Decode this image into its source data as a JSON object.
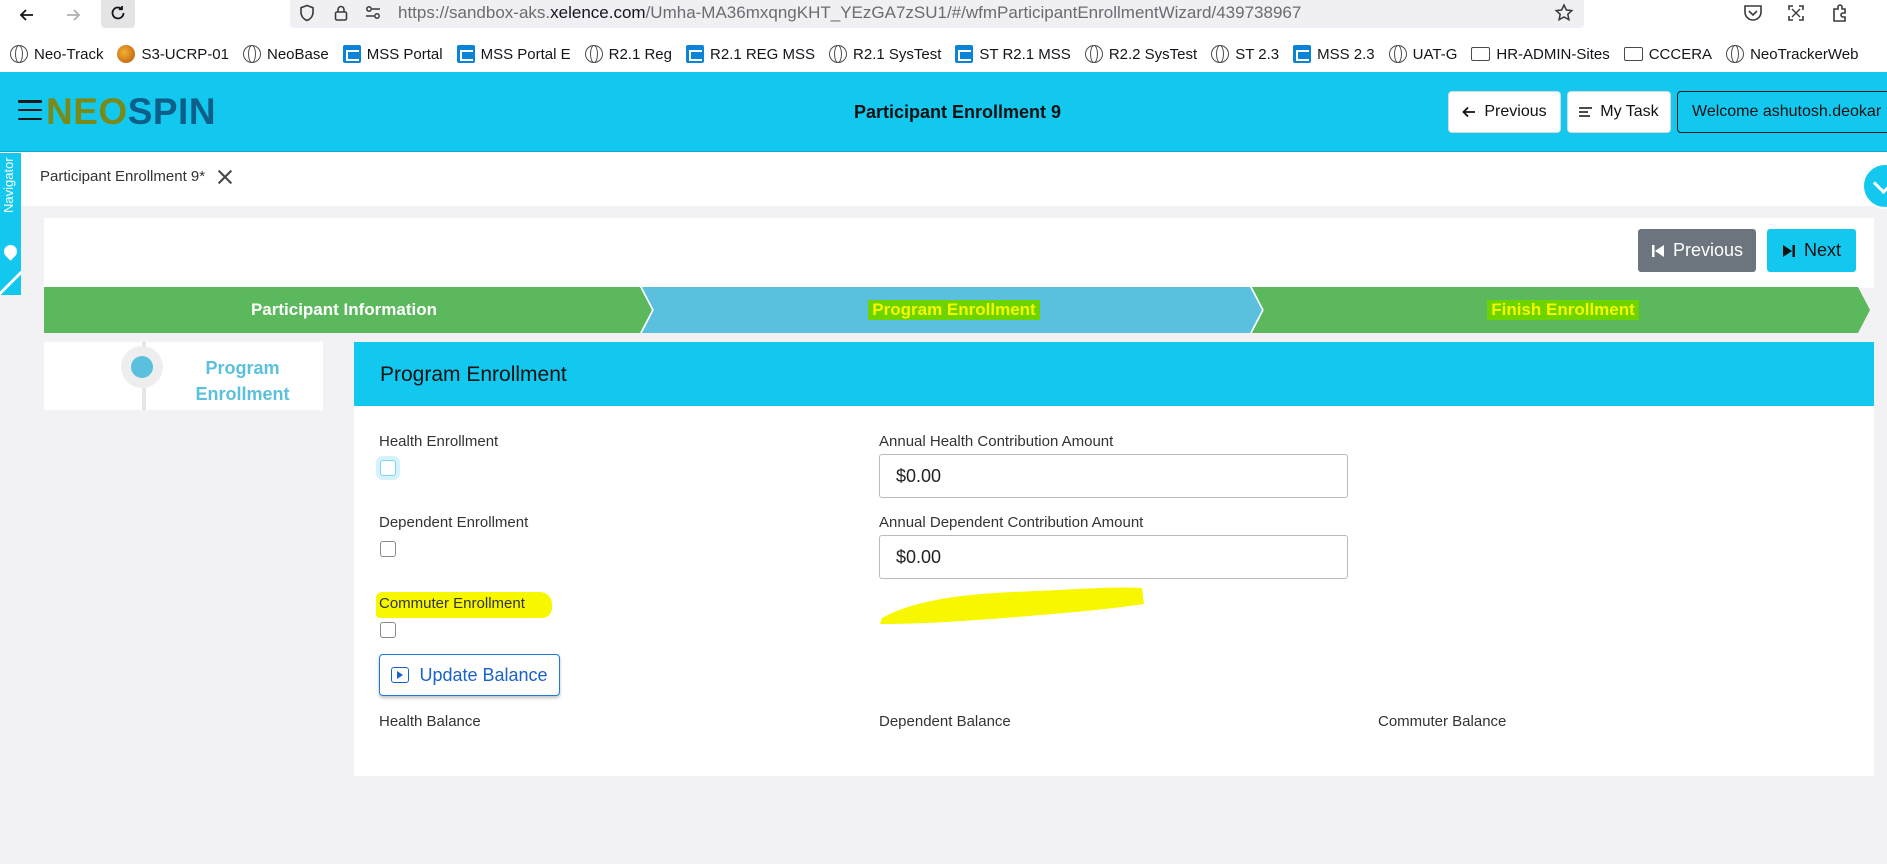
{
  "browser": {
    "url_prefix": "https://sandbox-aks.",
    "url_domain": "xelence.com",
    "url_path": "/Umha-MA36mxqngKHT_YEzGA7zSU1/#/wfmParticipantEnrollmentWizard/439738967",
    "bookmarks": [
      {
        "label": "Neo-Track",
        "icon": "globe-icon"
      },
      {
        "label": "S3-UCRP-01",
        "icon": "orange-logo-icon"
      },
      {
        "label": "NeoBase",
        "icon": "globe-icon"
      },
      {
        "label": "MSS Portal",
        "icon": "mss-icon"
      },
      {
        "label": "MSS Portal E",
        "icon": "mss-icon"
      },
      {
        "label": "R2.1 Reg",
        "icon": "globe-icon"
      },
      {
        "label": "R2.1 REG MSS",
        "icon": "mss-icon"
      },
      {
        "label": "R2.1 SysTest",
        "icon": "globe-icon"
      },
      {
        "label": "ST R2.1 MSS",
        "icon": "mss-icon"
      },
      {
        "label": "R2.2 SysTest",
        "icon": "globe-icon"
      },
      {
        "label": "ST 2.3",
        "icon": "globe-icon"
      },
      {
        "label": "MSS 2.3",
        "icon": "mss-icon"
      },
      {
        "label": "UAT-G",
        "icon": "globe-icon"
      },
      {
        "label": "HR-ADMIN-Sites",
        "icon": "folder-icon"
      },
      {
        "label": "CCCERA",
        "icon": "folder-icon"
      },
      {
        "label": "NeoTrackerWeb",
        "icon": "globe-icon"
      }
    ]
  },
  "header": {
    "logo_part1": "NEO",
    "logo_part2": "SPIN",
    "title": "Participant Enrollment 9",
    "previous_label": "Previous",
    "mytask_label": "My Task",
    "welcome_label": "Welcome ashutosh.deokar"
  },
  "tabs": {
    "navigator_label": "Navigator",
    "active_tab_label": "Participant Enrollment 9*"
  },
  "wizard": {
    "previous_label": "Previous",
    "next_label": "Next",
    "steps": [
      {
        "label": "Participant Information",
        "color": "#5cb85c",
        "text_color": "#ffffff"
      },
      {
        "label": "Program Enrollment",
        "color": "#5bc0de",
        "text_color": "#f7f700",
        "highlight": "#6dd400"
      },
      {
        "label": "Finish Enrollment",
        "color": "#5cb85c",
        "text_color": "#f7f700",
        "highlight": "#6dd400"
      }
    ],
    "side_step_label": "Program Enrollment"
  },
  "panel": {
    "title": "Program Enrollment",
    "health_enrollment_label": "Health Enrollment",
    "dependent_enrollment_label": "Dependent Enrollment",
    "commuter_enrollment_label": "Commuter Enrollment",
    "annual_health_label": "Annual Health Contribution Amount",
    "annual_health_value": "$0.00",
    "annual_dependent_label": "Annual Dependent Contribution Amount",
    "annual_dependent_value": "$0.00",
    "update_balance_label": "Update Balance",
    "health_balance_label": "Health Balance",
    "dependent_balance_label": "Dependent Balance",
    "commuter_balance_label": "Commuter Balance"
  },
  "colors": {
    "accent": "#13c8ee",
    "step_green": "#5cb85c",
    "step_blue": "#5bc0de",
    "highlighter_yellow": "#f7f700",
    "secondary_button": "#6c757d"
  }
}
